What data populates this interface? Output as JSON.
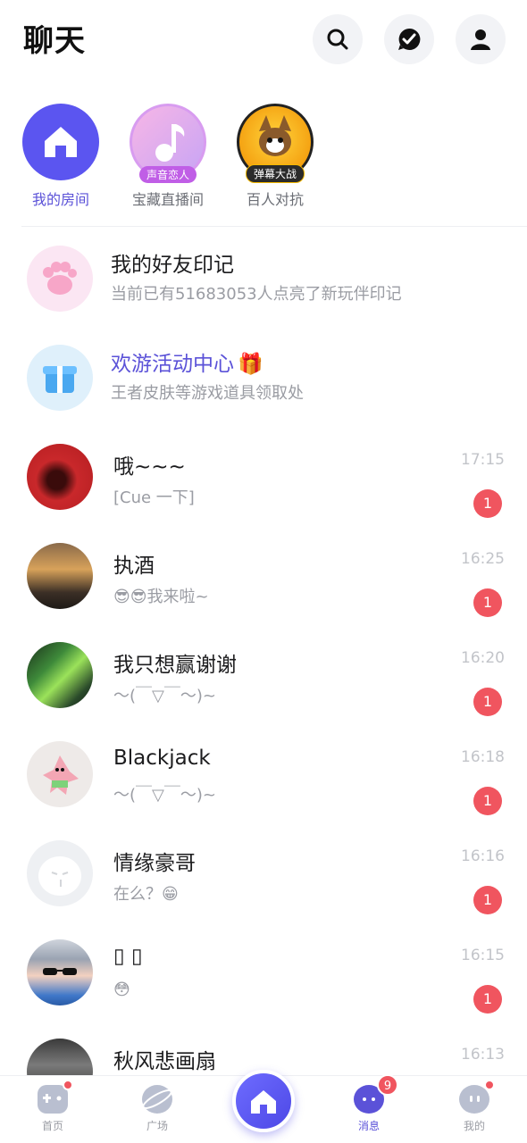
{
  "header": {
    "title": "聊天"
  },
  "quick_access": [
    {
      "label": "我的房间",
      "badge": "",
      "active": true
    },
    {
      "label": "宝藏直播间",
      "badge": "声音恋人",
      "active": false
    },
    {
      "label": "百人对抗",
      "badge": "弹幕大战",
      "active": false
    }
  ],
  "specials": [
    {
      "title": "我的好友印记",
      "subtitle": "当前已有51683053人点亮了新玩伴印记"
    },
    {
      "title": "欢游活动中心",
      "subtitle": "王者皮肤等游戏道具领取处",
      "emoji": "🎁"
    }
  ],
  "chats": [
    {
      "name": "哦~~~",
      "preview": "[Cue 一下]",
      "time": "17:15",
      "unread": "1"
    },
    {
      "name": "执酒",
      "preview": "😎😎我来啦~",
      "time": "16:25",
      "unread": "1"
    },
    {
      "name": "我只想赢谢谢",
      "preview": "～(￣▽￣～)~",
      "time": "16:20",
      "unread": "1"
    },
    {
      "name": "Blackjack",
      "preview": "～(￣▽￣～)~",
      "time": "16:18",
      "unread": "1"
    },
    {
      "name": "情缘豪哥",
      "preview": "在么？😁",
      "time": "16:16",
      "unread": "1"
    },
    {
      "name": "▯          ▯",
      "preview": "😳",
      "time": "16:15",
      "unread": "1"
    },
    {
      "name": "秋风悲画扇",
      "preview": "",
      "time": "16:13",
      "unread": ""
    }
  ],
  "bottom_nav": {
    "items": [
      {
        "label": "首页"
      },
      {
        "label": "广场"
      },
      {
        "label": "消息",
        "badge": "9"
      },
      {
        "label": "我的"
      }
    ]
  },
  "colors": {
    "accent": "#5b52d8",
    "badge": "#f0555f"
  }
}
